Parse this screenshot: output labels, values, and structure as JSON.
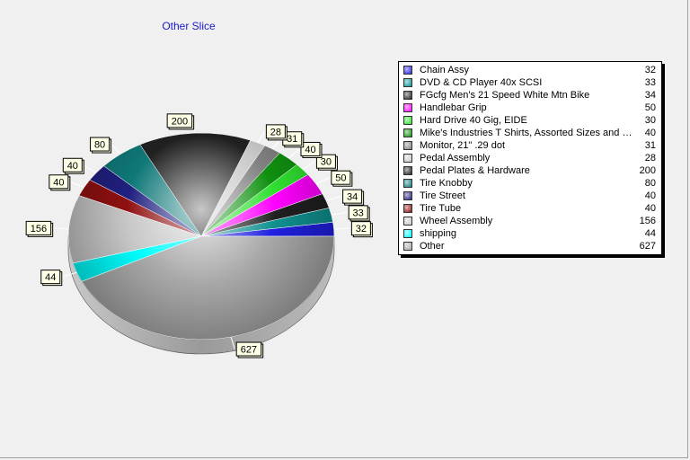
{
  "chart_data": {
    "type": "pie",
    "title": "Other Slice",
    "categories": [
      "Chain Assy",
      "DVD & CD Player 40x SCSI",
      "FGcfg Men's 21 Speed White Mtn Bike",
      "Handlebar Grip",
      "Hard Drive 40 Gig, EIDE",
      "Mike's Industries T Shirts, Assorted Sizes and Col...",
      "Monitor, 21\" .29 dot",
      "Pedal Assembly",
      "Pedal Plates & Hardware",
      "Tire Knobby",
      "Tire Street",
      "Tire Tube",
      "Wheel Assembly",
      "shipping",
      "Other"
    ],
    "values": [
      32,
      33,
      34,
      50,
      30,
      40,
      31,
      28,
      200,
      80,
      40,
      40,
      156,
      44,
      627
    ],
    "colors": [
      "#2020e0",
      "#109090",
      "#202020",
      "#ff00ff",
      "#30e030",
      "#109010",
      "#808080",
      "#c8c8c8",
      "#202020",
      "#107878",
      "#202080",
      "#901010",
      "#c8c8c8",
      "#00ffff",
      "#a8a8a8"
    ],
    "legend_position": "right"
  }
}
